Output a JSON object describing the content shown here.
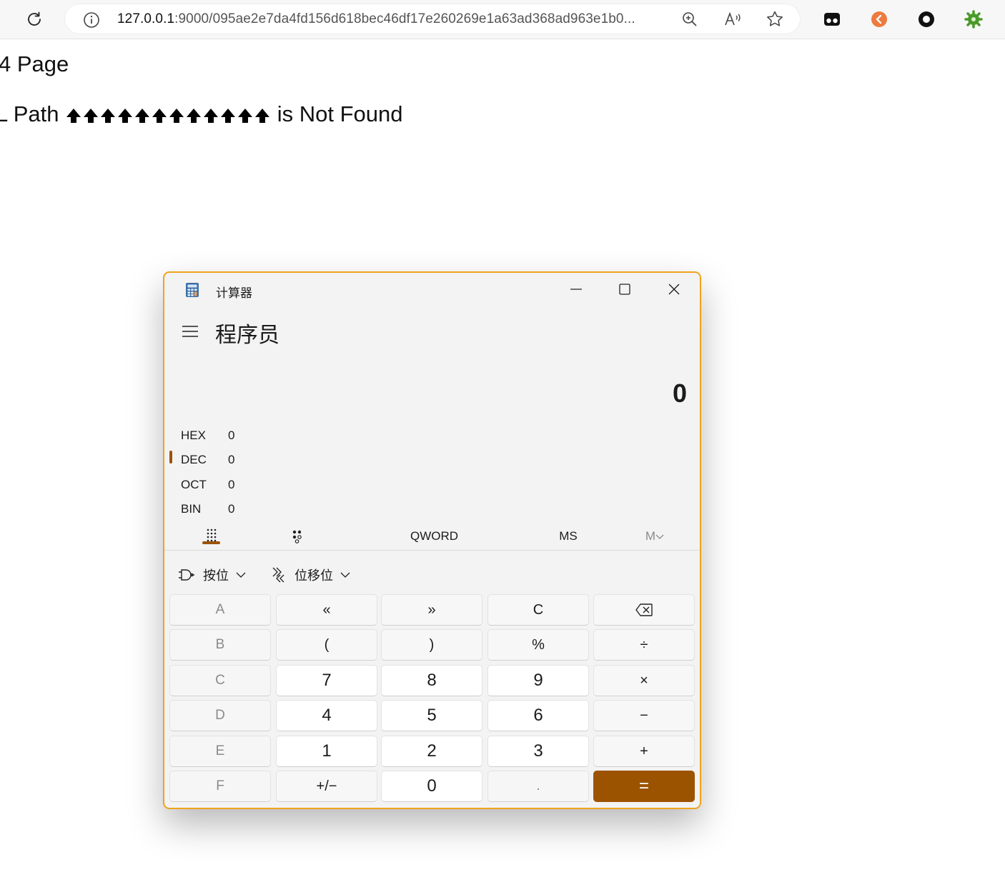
{
  "browser": {
    "url_host": "127.0.0.1",
    "url_rest": ":9000/095ae2e7da4fd156d618bec46df17e260269e1a63ad368ad963e1b0..."
  },
  "page": {
    "title": "4 Page",
    "message_prefix": "L Path",
    "message_glyph_count": 12,
    "message_suffix": "is Not Found"
  },
  "calculator": {
    "window_title": "计算器",
    "mode": "程序员",
    "display": "0",
    "radix": [
      {
        "name": "HEX",
        "value": "0"
      },
      {
        "name": "DEC",
        "value": "0"
      },
      {
        "name": "OCT",
        "value": "0"
      },
      {
        "name": "BIN",
        "value": "0"
      }
    ],
    "selected_radix": "DEC",
    "word_size": "QWORD",
    "memory_store": "MS",
    "memory_recall": "M",
    "bitwise_label": "按位",
    "bitshift_label": "位移位",
    "keys": [
      [
        "A",
        "«",
        "»",
        "C",
        "backspace"
      ],
      [
        "B",
        "(",
        ")",
        "%",
        "÷"
      ],
      [
        "C",
        "7",
        "8",
        "9",
        "×"
      ],
      [
        "D",
        "4",
        "5",
        "6",
        "−"
      ],
      [
        "E",
        "1",
        "2",
        "3",
        "+"
      ],
      [
        "F",
        "+/−",
        "0",
        ".",
        "="
      ]
    ],
    "accent_color": "#9c5300",
    "window_border_color": "#f0a31e"
  }
}
